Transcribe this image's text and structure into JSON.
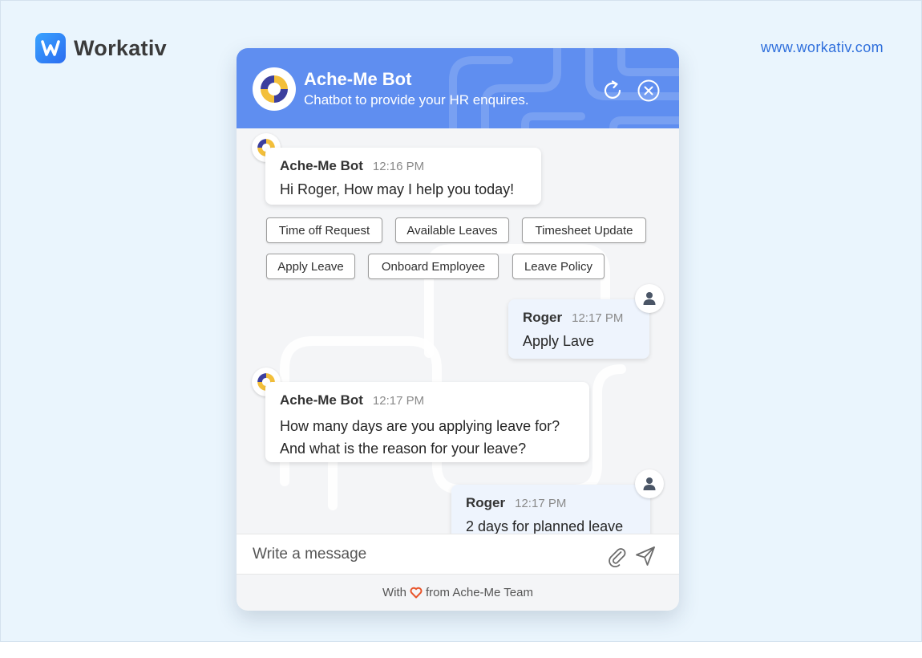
{
  "brand": {
    "name": "Workativ",
    "url": "www.workativ.com"
  },
  "header": {
    "title": "Ache-Me Bot",
    "subtitle": "Chatbot to provide your HR enquires."
  },
  "messages": [
    {
      "sender": "Ache-Me Bot",
      "time": "12:16 PM",
      "lines": [
        "Hi Roger, How may I help you today!"
      ]
    },
    {
      "sender": "Roger",
      "time": "12:17 PM",
      "lines": [
        "Apply Lave"
      ]
    },
    {
      "sender": "Ache-Me Bot",
      "time": "12:17 PM",
      "lines": [
        "How many days are you applying leave for?",
        "And what is the reason for your leave?"
      ]
    },
    {
      "sender": "Roger",
      "time": "12:17 PM",
      "lines": [
        "2 days for planned leave"
      ]
    }
  ],
  "quick_replies": [
    "Time off Request",
    "Available Leaves",
    "Timesheet Update",
    "Apply Leave",
    "Onboard Employee",
    "Leave Policy"
  ],
  "composer": {
    "placeholder": "Write a message"
  },
  "footer": {
    "prefix": "With",
    "suffix": "from Ache-Me Team"
  },
  "colors": {
    "header": "#5f8ef0",
    "link": "#2f6fdc",
    "heart": "#e8542a",
    "user_bubble": "#eef4fd"
  }
}
